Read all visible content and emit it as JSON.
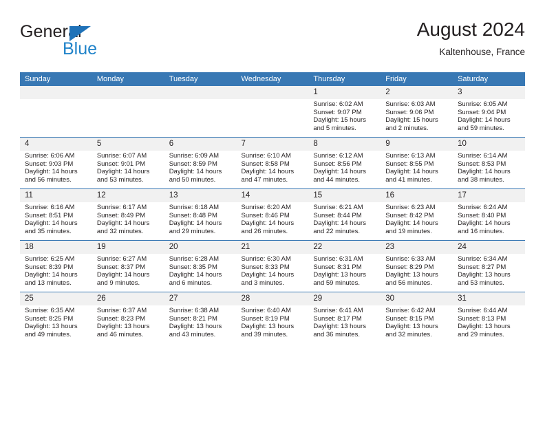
{
  "brand": {
    "name_top": "General",
    "name_bottom": "Blue",
    "logo_icon": "triangle-logo-icon"
  },
  "header": {
    "title": "August 2024",
    "location": "Kaltenhouse, France"
  },
  "colors": {
    "header_blue": "#3878b4",
    "brand_blue": "#2083c9",
    "daynum_bg": "#f1f1f1",
    "text": "#231f20"
  },
  "calendar": {
    "weekday_headers": [
      "Sunday",
      "Monday",
      "Tuesday",
      "Wednesday",
      "Thursday",
      "Friday",
      "Saturday"
    ],
    "weeks": [
      [
        {
          "day": "",
          "empty": true
        },
        {
          "day": "",
          "empty": true
        },
        {
          "day": "",
          "empty": true
        },
        {
          "day": "",
          "empty": true
        },
        {
          "day": "1",
          "sunrise": "Sunrise: 6:02 AM",
          "sunset": "Sunset: 9:07 PM",
          "daylight_1": "Daylight: 15 hours",
          "daylight_2": "and 5 minutes."
        },
        {
          "day": "2",
          "sunrise": "Sunrise: 6:03 AM",
          "sunset": "Sunset: 9:06 PM",
          "daylight_1": "Daylight: 15 hours",
          "daylight_2": "and 2 minutes."
        },
        {
          "day": "3",
          "sunrise": "Sunrise: 6:05 AM",
          "sunset": "Sunset: 9:04 PM",
          "daylight_1": "Daylight: 14 hours",
          "daylight_2": "and 59 minutes."
        }
      ],
      [
        {
          "day": "4",
          "sunrise": "Sunrise: 6:06 AM",
          "sunset": "Sunset: 9:03 PM",
          "daylight_1": "Daylight: 14 hours",
          "daylight_2": "and 56 minutes."
        },
        {
          "day": "5",
          "sunrise": "Sunrise: 6:07 AM",
          "sunset": "Sunset: 9:01 PM",
          "daylight_1": "Daylight: 14 hours",
          "daylight_2": "and 53 minutes."
        },
        {
          "day": "6",
          "sunrise": "Sunrise: 6:09 AM",
          "sunset": "Sunset: 8:59 PM",
          "daylight_1": "Daylight: 14 hours",
          "daylight_2": "and 50 minutes."
        },
        {
          "day": "7",
          "sunrise": "Sunrise: 6:10 AM",
          "sunset": "Sunset: 8:58 PM",
          "daylight_1": "Daylight: 14 hours",
          "daylight_2": "and 47 minutes."
        },
        {
          "day": "8",
          "sunrise": "Sunrise: 6:12 AM",
          "sunset": "Sunset: 8:56 PM",
          "daylight_1": "Daylight: 14 hours",
          "daylight_2": "and 44 minutes."
        },
        {
          "day": "9",
          "sunrise": "Sunrise: 6:13 AM",
          "sunset": "Sunset: 8:55 PM",
          "daylight_1": "Daylight: 14 hours",
          "daylight_2": "and 41 minutes."
        },
        {
          "day": "10",
          "sunrise": "Sunrise: 6:14 AM",
          "sunset": "Sunset: 8:53 PM",
          "daylight_1": "Daylight: 14 hours",
          "daylight_2": "and 38 minutes."
        }
      ],
      [
        {
          "day": "11",
          "sunrise": "Sunrise: 6:16 AM",
          "sunset": "Sunset: 8:51 PM",
          "daylight_1": "Daylight: 14 hours",
          "daylight_2": "and 35 minutes."
        },
        {
          "day": "12",
          "sunrise": "Sunrise: 6:17 AM",
          "sunset": "Sunset: 8:49 PM",
          "daylight_1": "Daylight: 14 hours",
          "daylight_2": "and 32 minutes."
        },
        {
          "day": "13",
          "sunrise": "Sunrise: 6:18 AM",
          "sunset": "Sunset: 8:48 PM",
          "daylight_1": "Daylight: 14 hours",
          "daylight_2": "and 29 minutes."
        },
        {
          "day": "14",
          "sunrise": "Sunrise: 6:20 AM",
          "sunset": "Sunset: 8:46 PM",
          "daylight_1": "Daylight: 14 hours",
          "daylight_2": "and 26 minutes."
        },
        {
          "day": "15",
          "sunrise": "Sunrise: 6:21 AM",
          "sunset": "Sunset: 8:44 PM",
          "daylight_1": "Daylight: 14 hours",
          "daylight_2": "and 22 minutes."
        },
        {
          "day": "16",
          "sunrise": "Sunrise: 6:23 AM",
          "sunset": "Sunset: 8:42 PM",
          "daylight_1": "Daylight: 14 hours",
          "daylight_2": "and 19 minutes."
        },
        {
          "day": "17",
          "sunrise": "Sunrise: 6:24 AM",
          "sunset": "Sunset: 8:40 PM",
          "daylight_1": "Daylight: 14 hours",
          "daylight_2": "and 16 minutes."
        }
      ],
      [
        {
          "day": "18",
          "sunrise": "Sunrise: 6:25 AM",
          "sunset": "Sunset: 8:39 PM",
          "daylight_1": "Daylight: 14 hours",
          "daylight_2": "and 13 minutes."
        },
        {
          "day": "19",
          "sunrise": "Sunrise: 6:27 AM",
          "sunset": "Sunset: 8:37 PM",
          "daylight_1": "Daylight: 14 hours",
          "daylight_2": "and 9 minutes."
        },
        {
          "day": "20",
          "sunrise": "Sunrise: 6:28 AM",
          "sunset": "Sunset: 8:35 PM",
          "daylight_1": "Daylight: 14 hours",
          "daylight_2": "and 6 minutes."
        },
        {
          "day": "21",
          "sunrise": "Sunrise: 6:30 AM",
          "sunset": "Sunset: 8:33 PM",
          "daylight_1": "Daylight: 14 hours",
          "daylight_2": "and 3 minutes."
        },
        {
          "day": "22",
          "sunrise": "Sunrise: 6:31 AM",
          "sunset": "Sunset: 8:31 PM",
          "daylight_1": "Daylight: 13 hours",
          "daylight_2": "and 59 minutes."
        },
        {
          "day": "23",
          "sunrise": "Sunrise: 6:33 AM",
          "sunset": "Sunset: 8:29 PM",
          "daylight_1": "Daylight: 13 hours",
          "daylight_2": "and 56 minutes."
        },
        {
          "day": "24",
          "sunrise": "Sunrise: 6:34 AM",
          "sunset": "Sunset: 8:27 PM",
          "daylight_1": "Daylight: 13 hours",
          "daylight_2": "and 53 minutes."
        }
      ],
      [
        {
          "day": "25",
          "sunrise": "Sunrise: 6:35 AM",
          "sunset": "Sunset: 8:25 PM",
          "daylight_1": "Daylight: 13 hours",
          "daylight_2": "and 49 minutes."
        },
        {
          "day": "26",
          "sunrise": "Sunrise: 6:37 AM",
          "sunset": "Sunset: 8:23 PM",
          "daylight_1": "Daylight: 13 hours",
          "daylight_2": "and 46 minutes."
        },
        {
          "day": "27",
          "sunrise": "Sunrise: 6:38 AM",
          "sunset": "Sunset: 8:21 PM",
          "daylight_1": "Daylight: 13 hours",
          "daylight_2": "and 43 minutes."
        },
        {
          "day": "28",
          "sunrise": "Sunrise: 6:40 AM",
          "sunset": "Sunset: 8:19 PM",
          "daylight_1": "Daylight: 13 hours",
          "daylight_2": "and 39 minutes."
        },
        {
          "day": "29",
          "sunrise": "Sunrise: 6:41 AM",
          "sunset": "Sunset: 8:17 PM",
          "daylight_1": "Daylight: 13 hours",
          "daylight_2": "and 36 minutes."
        },
        {
          "day": "30",
          "sunrise": "Sunrise: 6:42 AM",
          "sunset": "Sunset: 8:15 PM",
          "daylight_1": "Daylight: 13 hours",
          "daylight_2": "and 32 minutes."
        },
        {
          "day": "31",
          "sunrise": "Sunrise: 6:44 AM",
          "sunset": "Sunset: 8:13 PM",
          "daylight_1": "Daylight: 13 hours",
          "daylight_2": "and 29 minutes."
        }
      ]
    ]
  }
}
